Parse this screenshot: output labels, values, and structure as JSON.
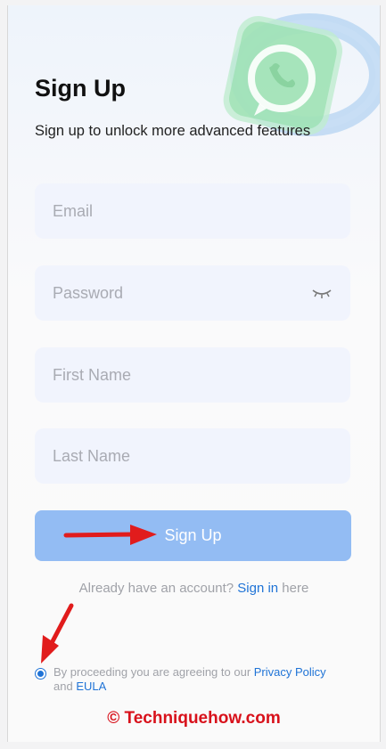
{
  "header": {
    "title": "Sign Up",
    "subtitle": "Sign up to unlock more advanced features"
  },
  "form": {
    "email_placeholder": "Email",
    "password_placeholder": "Password",
    "first_name_placeholder": "First Name",
    "last_name_placeholder": "Last Name",
    "password_toggle_icon": "eye-closed-icon"
  },
  "actions": {
    "signup_label": "Sign Up"
  },
  "signin": {
    "prefix": "Already have an account? ",
    "link": "Sign in",
    "suffix": " here"
  },
  "agreement": {
    "checked": true,
    "prefix": "By proceeding you are agreeing to our ",
    "privacy_link": "Privacy Policy",
    "and": " and ",
    "eula_link": "EULA"
  },
  "watermark": "© Techniquehow.com",
  "colors": {
    "accent": "#1f73d6",
    "button": "#93bcf3",
    "annotation": "#e11c1c",
    "field_bg": "#f1f4fd"
  }
}
